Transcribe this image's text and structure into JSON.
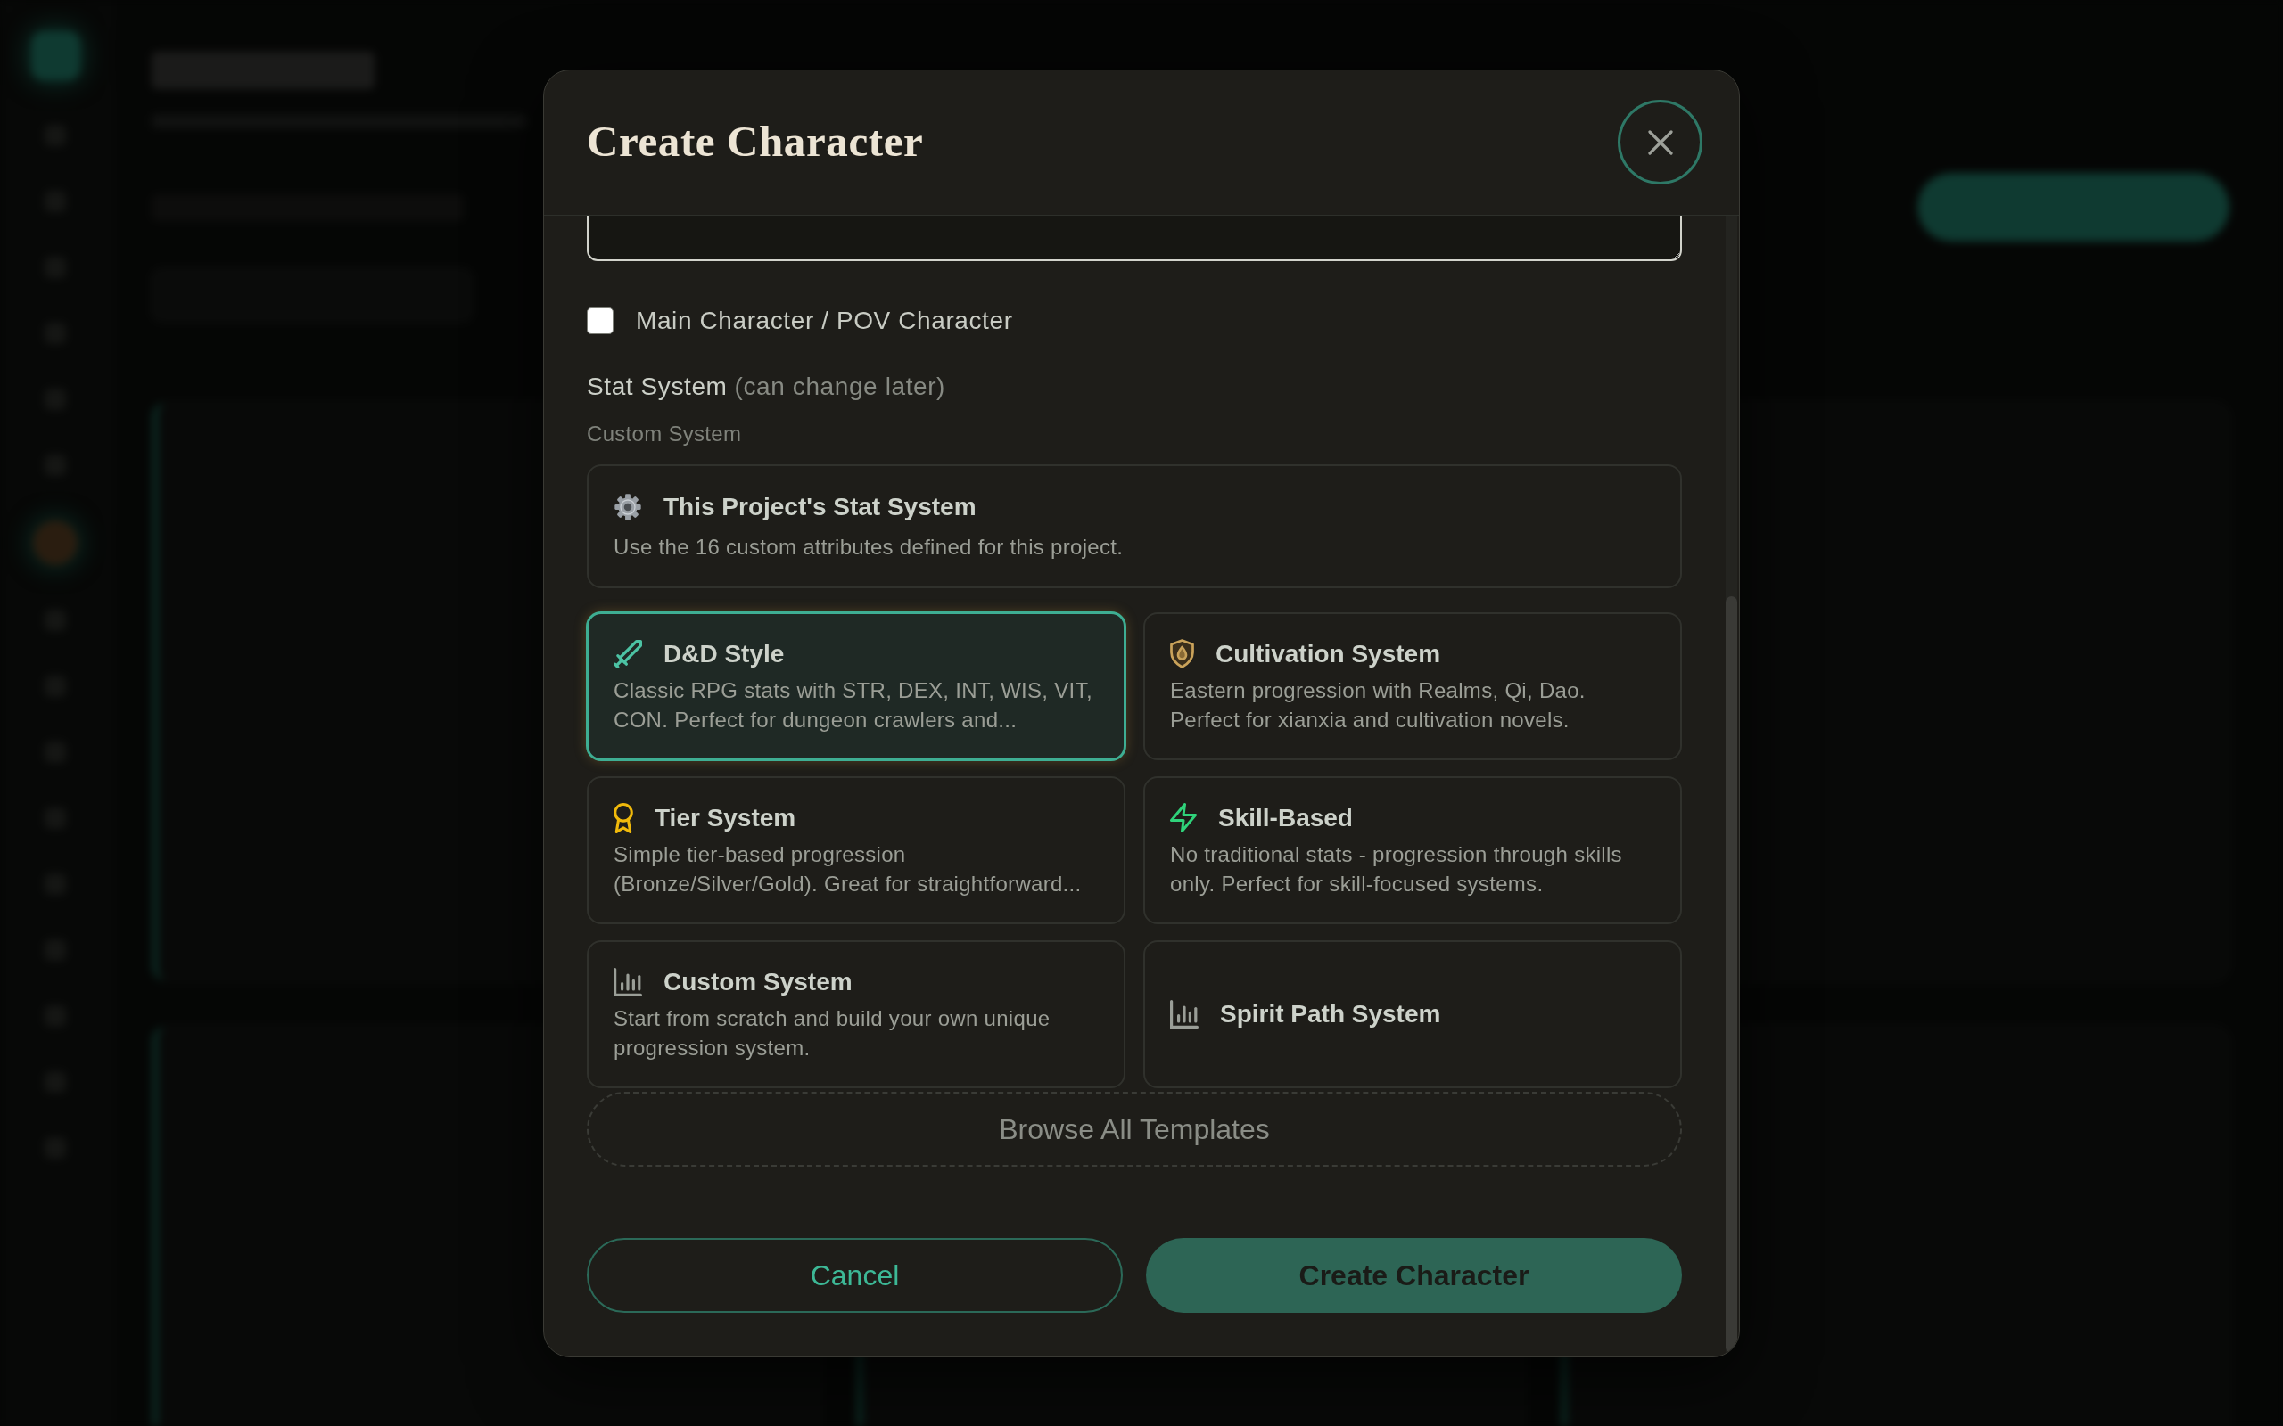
{
  "dialog": {
    "title": "Create Character"
  },
  "main_character": {
    "label": "Main Character / POV Character",
    "checked": false
  },
  "stat_system": {
    "label": "Stat System",
    "hint": "(can change later)",
    "section_label": "Custom System",
    "project_system": {
      "title": "This Project's Stat System",
      "description": "Use the 16 custom attributes defined for this project.",
      "selected": false
    },
    "templates": [
      {
        "title": "D&D Style",
        "description": "Classic RPG stats with STR, DEX, INT, WIS, VIT, CON. Perfect for dungeon crawlers and...",
        "selected": true
      },
      {
        "title": "Cultivation System",
        "description": "Eastern progression with Realms, Qi, Dao. Perfect for xianxia and cultivation novels.",
        "selected": false
      },
      {
        "title": "Tier System",
        "description": "Simple tier-based progression (Bronze/Silver/Gold). Great for straightforward...",
        "selected": false
      },
      {
        "title": "Skill-Based",
        "description": "No traditional stats - progression through skills only. Perfect for skill-focused systems.",
        "selected": false
      },
      {
        "title": "Custom System",
        "description": "Start from scratch and build your own unique progression system.",
        "selected": false
      },
      {
        "title": "Spirit Path System",
        "selected": false
      }
    ],
    "browse_button": "Browse All Templates"
  },
  "buttons": [
    {
      "label": "Cancel",
      "kind": "secondary"
    },
    {
      "label": "Create Character",
      "kind": "primary"
    }
  ]
}
